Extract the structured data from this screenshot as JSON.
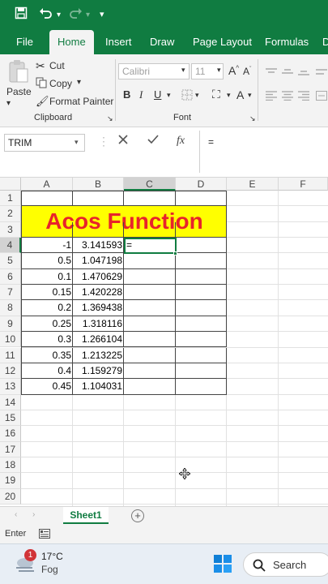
{
  "qat": {
    "save": "save-icon",
    "undo": "undo-icon",
    "redo": "redo-icon",
    "more": "customize-icon"
  },
  "tabs": [
    "File",
    "Home",
    "Insert",
    "Draw",
    "Page Layout",
    "Formulas",
    "D"
  ],
  "clipboard": {
    "paste": "Paste",
    "cut": "Cut",
    "copy": "Copy",
    "format_painter": "Format Painter",
    "group": "Clipboard"
  },
  "font": {
    "name": "Calibri",
    "size": "11",
    "group": "Font"
  },
  "formula_bar": {
    "name_box": "TRIM",
    "fx": "fx",
    "content": "="
  },
  "columns": [
    "A",
    "B",
    "C",
    "D",
    "E",
    "F"
  ],
  "rows": [
    "1",
    "2",
    "3",
    "4",
    "5",
    "6",
    "7",
    "8",
    "9",
    "10",
    "11",
    "12",
    "13",
    "14",
    "15",
    "16",
    "17",
    "18",
    "19",
    "20"
  ],
  "title": "Acos Function",
  "data": [
    {
      "a": "-1",
      "b": "3.141593",
      "c": "="
    },
    {
      "a": "0.5",
      "b": "1.047198",
      "c": ""
    },
    {
      "a": "0.1",
      "b": "1.470629",
      "c": ""
    },
    {
      "a": "0.15",
      "b": "1.420228",
      "c": ""
    },
    {
      "a": "0.2",
      "b": "1.369438",
      "c": ""
    },
    {
      "a": "0.25",
      "b": "1.318116",
      "c": ""
    },
    {
      "a": "0.3",
      "b": "1.266104",
      "c": ""
    },
    {
      "a": "0.35",
      "b": "1.213225",
      "c": ""
    },
    {
      "a": "0.4",
      "b": "1.159279",
      "c": ""
    },
    {
      "a": "0.45",
      "b": "1.104031",
      "c": ""
    }
  ],
  "sheet": {
    "name": "Sheet1",
    "add": "+"
  },
  "status": {
    "mode": "Enter"
  },
  "taskbar": {
    "weather_badge": "1",
    "temp": "17°C",
    "condition": "Fog",
    "search": "Search"
  },
  "colors": {
    "excel_green": "#107c41",
    "title_fill": "#ffff00",
    "title_text": "#e8232b"
  }
}
